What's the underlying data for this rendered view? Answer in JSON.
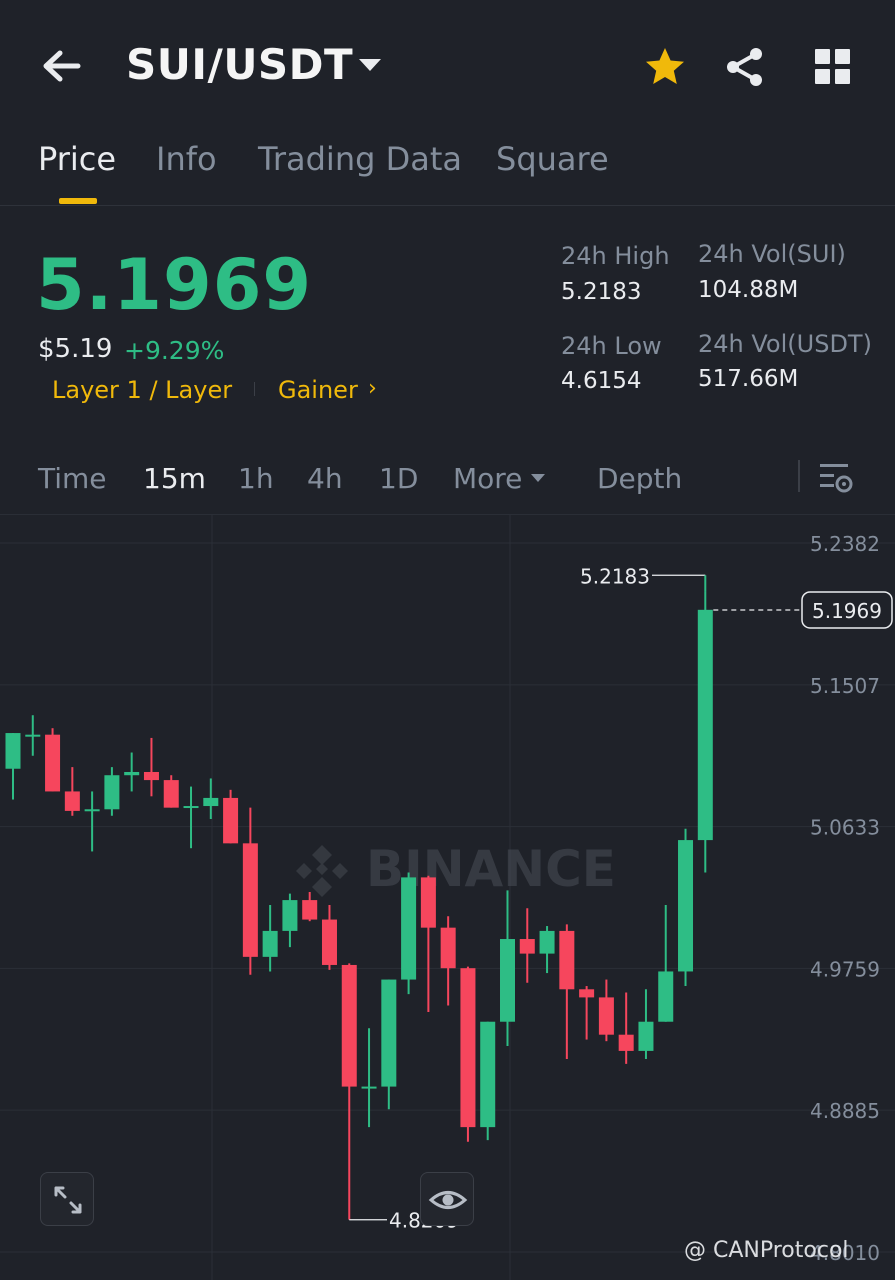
{
  "header": {
    "pair": "SUI/USDT",
    "icons": [
      "back-arrow-icon",
      "caret-down-icon",
      "star-icon",
      "share-icon",
      "grid-icon"
    ],
    "star_color": "#f0b90b"
  },
  "tabs": [
    {
      "label": "Price",
      "active": true
    },
    {
      "label": "Info",
      "active": false
    },
    {
      "label": "Trading Data",
      "active": false
    },
    {
      "label": "Square",
      "active": false
    }
  ],
  "ticker": {
    "last_price": "5.1969",
    "usd_price": "$5.19",
    "change": "+9.29%",
    "tag_layer": "Layer 1 / Layer",
    "tag_gainer": "Gainer",
    "tag_chevron": "›",
    "high_label": "24h High",
    "high_value": "5.2183",
    "low_label": "24h Low",
    "low_value": "4.6154",
    "vol_base_label": "24h Vol(SUI)",
    "vol_base_value": "104.88M",
    "vol_quote_label": "24h Vol(USDT)",
    "vol_quote_value": "517.66M",
    "up_color": "#2ebd85",
    "down_color": "#f6465d"
  },
  "intervals": {
    "items": [
      "Time",
      "15m",
      "1h",
      "4h",
      "1D",
      "More",
      "Depth"
    ],
    "active": "15m"
  },
  "chart_data": {
    "type": "candlestick",
    "interval": "15m",
    "y_ticks": [
      "5.2382",
      "5.1507",
      "5.0633",
      "4.9759",
      "4.8885",
      "4.8010"
    ],
    "ylim": [
      4.801,
      5.2382
    ],
    "current_price_label": "5.1969",
    "high_marker": "5.2183",
    "low_marker": "4.8209",
    "watermark": "BINANCE",
    "candles": [
      {
        "o": 5.099,
        "h": 5.113,
        "l": 5.08,
        "c": 5.121
      },
      {
        "o": 5.12,
        "h": 5.132,
        "l": 5.107,
        "c": 5.12
      },
      {
        "o": 5.12,
        "h": 5.124,
        "l": 5.09,
        "c": 5.085
      },
      {
        "o": 5.085,
        "h": 5.1,
        "l": 5.07,
        "c": 5.073
      },
      {
        "o": 5.073,
        "h": 5.085,
        "l": 5.048,
        "c": 5.074
      },
      {
        "o": 5.074,
        "h": 5.1,
        "l": 5.07,
        "c": 5.095
      },
      {
        "o": 5.095,
        "h": 5.109,
        "l": 5.085,
        "c": 5.097
      },
      {
        "o": 5.097,
        "h": 5.118,
        "l": 5.082,
        "c": 5.092
      },
      {
        "o": 5.092,
        "h": 5.095,
        "l": 5.075,
        "c": 5.075
      },
      {
        "o": 5.075,
        "h": 5.088,
        "l": 5.05,
        "c": 5.076
      },
      {
        "o": 5.076,
        "h": 5.093,
        "l": 5.068,
        "c": 5.081
      },
      {
        "o": 5.081,
        "h": 5.086,
        "l": 5.055,
        "c": 5.053
      },
      {
        "o": 5.053,
        "h": 5.075,
        "l": 4.972,
        "c": 4.983
      },
      {
        "o": 4.983,
        "h": 5.015,
        "l": 4.974,
        "c": 4.999
      },
      {
        "o": 4.999,
        "h": 5.022,
        "l": 4.989,
        "c": 5.018
      },
      {
        "o": 5.018,
        "h": 5.023,
        "l": 5.005,
        "c": 5.006
      },
      {
        "o": 5.006,
        "h": 5.015,
        "l": 4.975,
        "c": 4.978
      },
      {
        "o": 4.978,
        "h": 4.979,
        "l": 4.821,
        "c": 4.903
      },
      {
        "o": 4.903,
        "h": 4.939,
        "l": 4.878,
        "c": 4.903
      },
      {
        "o": 4.903,
        "h": 4.963,
        "l": 4.889,
        "c": 4.969
      },
      {
        "o": 4.969,
        "h": 5.035,
        "l": 4.96,
        "c": 5.032
      },
      {
        "o": 5.032,
        "h": 5.033,
        "l": 4.949,
        "c": 5.001
      },
      {
        "o": 5.001,
        "h": 5.008,
        "l": 4.953,
        "c": 4.976
      },
      {
        "o": 4.976,
        "h": 4.977,
        "l": 4.869,
        "c": 4.878
      },
      {
        "o": 4.878,
        "h": 4.943,
        "l": 4.87,
        "c": 4.943
      },
      {
        "o": 4.943,
        "h": 5.024,
        "l": 4.928,
        "c": 4.994
      },
      {
        "o": 4.994,
        "h": 5.013,
        "l": 4.967,
        "c": 4.985
      },
      {
        "o": 4.985,
        "h": 5.002,
        "l": 4.973,
        "c": 4.999
      },
      {
        "o": 4.999,
        "h": 5.003,
        "l": 4.92,
        "c": 4.963
      },
      {
        "o": 4.963,
        "h": 4.965,
        "l": 4.932,
        "c": 4.958
      },
      {
        "o": 4.958,
        "h": 4.969,
        "l": 4.931,
        "c": 4.935
      },
      {
        "o": 4.935,
        "h": 4.961,
        "l": 4.917,
        "c": 4.925
      },
      {
        "o": 4.925,
        "h": 4.963,
        "l": 4.92,
        "c": 4.943
      },
      {
        "o": 4.943,
        "h": 5.015,
        "l": 4.977,
        "c": 4.974
      },
      {
        "o": 4.974,
        "h": 5.062,
        "l": 4.965,
        "c": 5.055
      },
      {
        "o": 5.055,
        "h": 5.208,
        "l": 5.035,
        "c": 5.197
      }
    ]
  },
  "footer": {
    "watermark": "@ CANProtocol",
    "icons": [
      "expand-icon",
      "eye-icon"
    ]
  }
}
